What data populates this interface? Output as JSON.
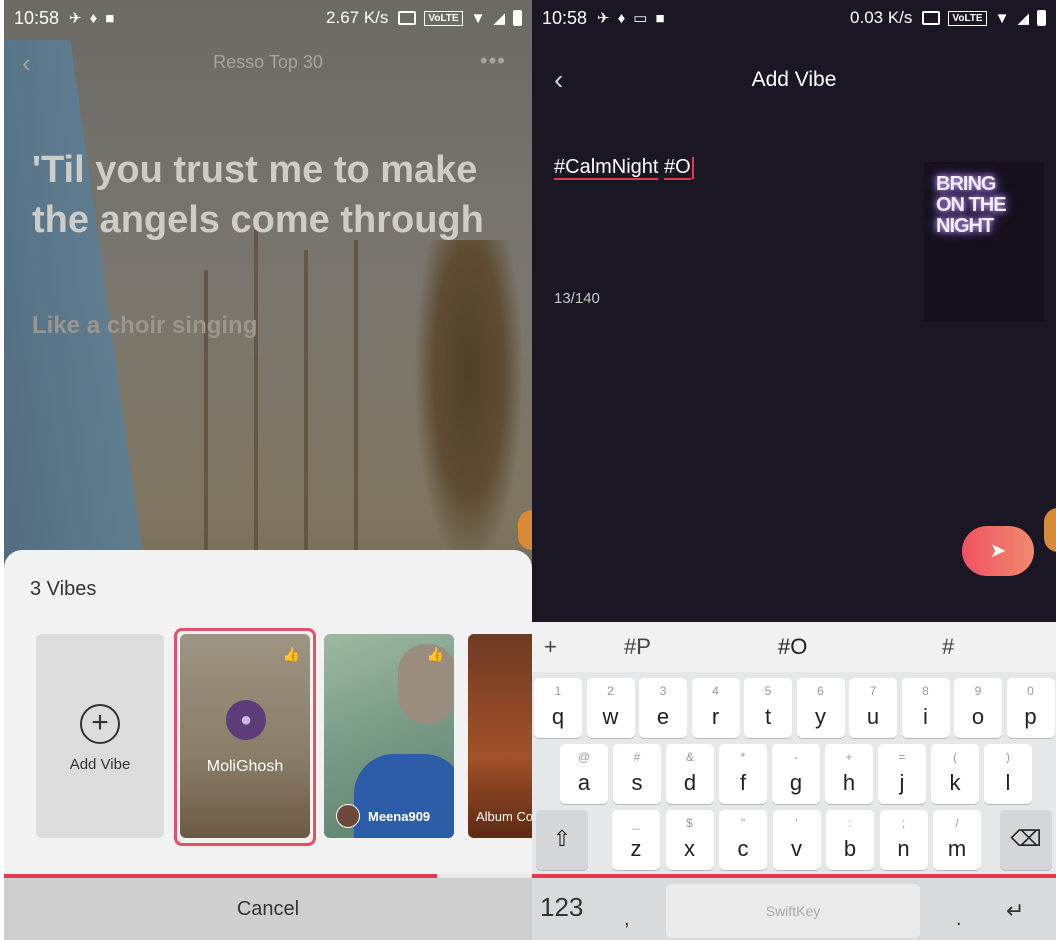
{
  "left": {
    "status": {
      "time": "10:58",
      "speed": "2.67 K/s",
      "volte": "VoLTE"
    },
    "header_title": "Resso Top 30",
    "lyrics": {
      "line1": "'Til you trust me to make the angels come through",
      "line2": "Like a choir singing"
    },
    "sheet": {
      "title": "3 Vibes",
      "add_label": "Add Vibe",
      "cards": [
        {
          "user": "MoliGhosh"
        },
        {
          "user": "Meena909"
        },
        {
          "user": "Album Co"
        }
      ],
      "cancel_label": "Cancel",
      "progress": 0.82
    }
  },
  "right": {
    "status": {
      "time": "10:58",
      "speed": "0.03 K/s",
      "volte": "VoLTE"
    },
    "title": "Add Vibe",
    "tag1": "#CalmNight",
    "tag2": "#O",
    "counter": "13/140",
    "neon_text": "BRING ON THE NIGHT",
    "keyboard": {
      "suggestions": [
        "+",
        "#P",
        "#O",
        "#"
      ],
      "row1": [
        [
          "1",
          "q"
        ],
        [
          "2",
          "w"
        ],
        [
          "3",
          "e"
        ],
        [
          "4",
          "r"
        ],
        [
          "5",
          "t"
        ],
        [
          "6",
          "y"
        ],
        [
          "7",
          "u"
        ],
        [
          "8",
          "i"
        ],
        [
          "9",
          "o"
        ],
        [
          "0",
          "p"
        ]
      ],
      "row2": [
        [
          "@",
          "a"
        ],
        [
          "#",
          "s"
        ],
        [
          "&",
          "d"
        ],
        [
          "*",
          "f"
        ],
        [
          "-",
          "g"
        ],
        [
          "+",
          "h"
        ],
        [
          "=",
          "j"
        ],
        [
          "(",
          "k"
        ],
        [
          ")",
          "l"
        ]
      ],
      "row3": [
        [
          "_",
          "z"
        ],
        [
          "$",
          "x"
        ],
        [
          "\"",
          "c"
        ],
        [
          "'",
          "v"
        ],
        [
          ":",
          "b"
        ],
        [
          ";",
          "n"
        ],
        [
          "/",
          "m"
        ]
      ],
      "key_123": "123",
      "space_label": "SwiftKey",
      "comma": ",",
      "period": "."
    }
  }
}
